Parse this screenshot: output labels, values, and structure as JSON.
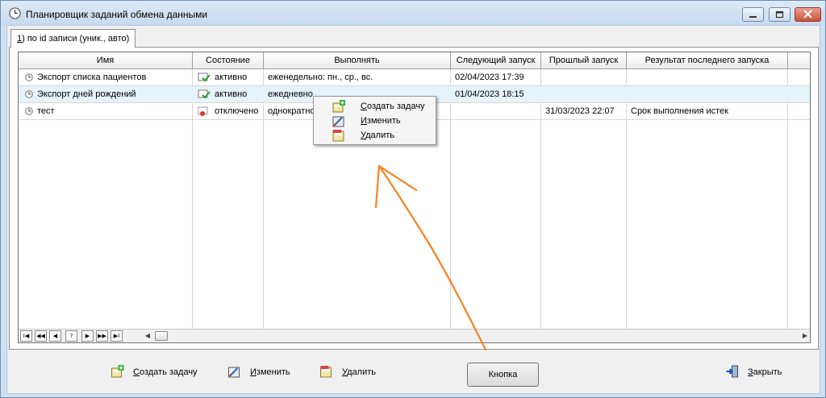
{
  "window": {
    "title": "Планировщик заданий обмена данными"
  },
  "tab": {
    "accel": "1",
    "label": ") по id записи (уник., авто)"
  },
  "grid": {
    "columns": [
      "Имя",
      "Состояние",
      "Выполнять",
      "Следующий запуск",
      "Прошлый запуск",
      "Результат последнего запуска"
    ],
    "rows": [
      {
        "name": "Экспорт списка пациентов",
        "state": "активно",
        "schedule": "еженедельно: пн., ср., вс.",
        "next": "02/04/2023  17:39",
        "prev": "",
        "result": ""
      },
      {
        "name": "Экспорт дней рождений",
        "state": "активно",
        "schedule": "ежедневно",
        "next": "01/04/2023  18:15",
        "prev": "",
        "result": ""
      },
      {
        "name": "тест",
        "state": "отключено",
        "schedule": "однократно",
        "next": "",
        "prev": "31/03/2023     22:07",
        "result": "Срок выполнения истек"
      }
    ]
  },
  "nav": {
    "first": "I◀",
    "prev_page": "◀◀",
    "prev": "◀",
    "query": "?",
    "next": "▶",
    "next_page": "▶▶",
    "last": "▶I"
  },
  "context_menu": {
    "create_accel": "С",
    "create_rest": "оздать задачу",
    "edit_accel": "И",
    "edit_rest": "зменить",
    "delete_accel": "У",
    "delete_rest": "далить"
  },
  "buttons": {
    "create_accel": "С",
    "create_rest": "оздать задачу",
    "edit_accel": "И",
    "edit_rest": "зменить",
    "delete_accel": "У",
    "delete_rest": "далить",
    "center": "Кнопка",
    "close_accel": "З",
    "close_rest": "акрыть"
  },
  "colors": {
    "window_frame": "#cfe0f2",
    "selected_row": "#e5f3fb",
    "annotation_arrow": "#f5821f"
  }
}
